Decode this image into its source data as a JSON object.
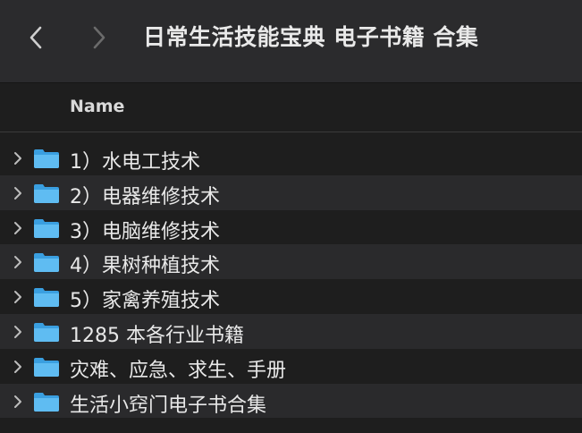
{
  "window": {
    "title": "日常生活技能宝典  电子书籍 合集"
  },
  "toolbar": {
    "back_icon": "chevron-left-icon",
    "forward_icon": "chevron-right-icon"
  },
  "list": {
    "column_name": "Name",
    "items": [
      {
        "label": "1）水电工技术",
        "icon": "folder-icon"
      },
      {
        "label": "2）电器维修技术",
        "icon": "folder-icon"
      },
      {
        "label": "3）电脑维修技术",
        "icon": "folder-icon"
      },
      {
        "label": "4）果树种植技术",
        "icon": "folder-icon"
      },
      {
        "label": "5）家禽养殖技术",
        "icon": "folder-icon"
      },
      {
        "label": "1285 本各行业书籍",
        "icon": "folder-icon"
      },
      {
        "label": "灾难、应急、求生、手册",
        "icon": "folder-icon"
      },
      {
        "label": "生活小窍门电子书合集",
        "icon": "folder-icon"
      }
    ]
  },
  "colors": {
    "toolbar_bg": "#2b2b2d",
    "list_bg": "#1e1e1e",
    "row_alt_bg": "#2a2a2c",
    "folder_blue": "#4fb0ec"
  }
}
